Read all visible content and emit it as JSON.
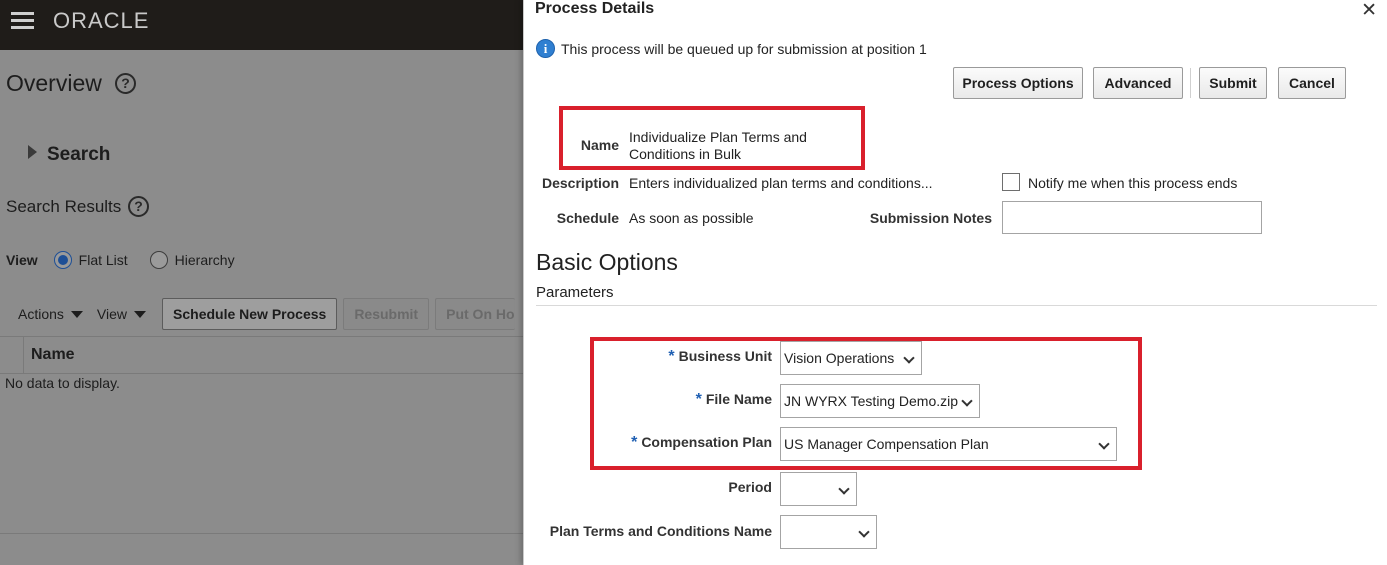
{
  "background": {
    "brand": "ORACLE",
    "title": "Overview",
    "help_glyph": "?",
    "search_label": "Search",
    "search_results_label": "Search Results",
    "view_label": "View",
    "view_options": [
      "Flat List",
      "Hierarchy"
    ],
    "view_selected": "Flat List",
    "toolbar": {
      "actions_label": "Actions",
      "view_menu_label": "View",
      "schedule_label": "Schedule New Process",
      "resubmit_label": "Resubmit",
      "put_on_hold_label": "Put On Ho"
    },
    "table": {
      "column_name": "Name",
      "empty_text": "No data to display."
    }
  },
  "dialog": {
    "title": "Process Details",
    "close_glyph": "✕",
    "info_text": "This process will be queued up for submission at position 1",
    "buttons": {
      "process_options": "Process Options",
      "advanced": "Advanced",
      "submit": "Submit",
      "cancel": "Cancel"
    },
    "fields": {
      "name_label": "Name",
      "name_value_line1": "Individualize Plan Terms and",
      "name_value_line2": "Conditions in Bulk",
      "description_label": "Description",
      "description_value": "Enters individualized plan terms and conditions...",
      "schedule_label": "Schedule",
      "schedule_value": "As soon as possible",
      "notify_label": "Notify me when this process ends",
      "notify_checked": false,
      "submission_notes_label": "Submission Notes",
      "submission_notes_value": ""
    },
    "basic_options_title": "Basic Options",
    "parameters_title": "Parameters",
    "parameters": {
      "required_marker": "*",
      "business_unit_label": "Business Unit",
      "business_unit_value": "Vision Operations",
      "file_name_label": "File Name",
      "file_name_value": "JN WYRX Testing Demo.zip",
      "compensation_plan_label": "Compensation Plan",
      "compensation_plan_value": "US Manager Compensation Plan",
      "period_label": "Period",
      "period_value": "",
      "plan_terms_label": "Plan Terms and Conditions Name",
      "plan_terms_value": ""
    }
  },
  "colors": {
    "highlight_red": "#d9202c",
    "header_dark": "#1f1c19",
    "info_blue": "#2f7fd1",
    "required_blue": "#2060b3",
    "overlay_gray": "#8c8c8c"
  }
}
